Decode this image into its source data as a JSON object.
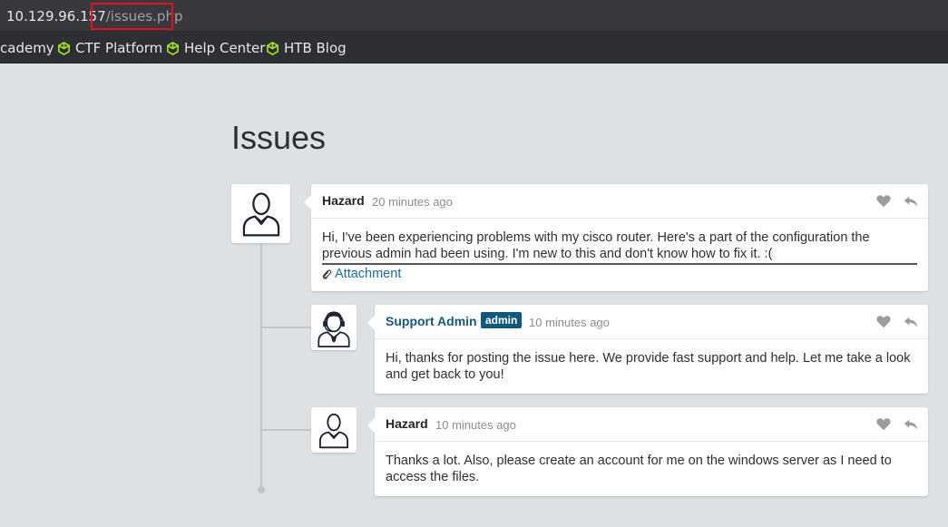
{
  "browser": {
    "url_host": "10.129.96.157",
    "url_path": "/issues.php",
    "bookmarks": [
      {
        "label": "cademy"
      },
      {
        "label": "CTF Platform"
      },
      {
        "label": "Help Center"
      },
      {
        "label": "HTB Blog"
      }
    ]
  },
  "page": {
    "title": "Issues"
  },
  "posts": [
    {
      "author": "Hazard",
      "time": "20 minutes ago",
      "body": "Hi, I've been experiencing problems with my cisco router. Here's a part of the configuration the previous admin had been using. I'm new to this and don't know how to fix it. :(",
      "attachment": "Attachment"
    },
    {
      "author": "Support Admin",
      "badge": "admin",
      "time": "10 minutes ago",
      "body": "Hi, thanks for posting the issue here. We provide fast support and help. Let me take a look and get back to you!"
    },
    {
      "author": "Hazard",
      "time": "10 minutes ago",
      "body": "Thanks a lot. Also, please create an account for me on the windows server as I need to access the files."
    }
  ],
  "colors": {
    "accent": "#17587f",
    "highlight_box": "#e0121e",
    "bookmark_icon": "#9fe01f"
  }
}
